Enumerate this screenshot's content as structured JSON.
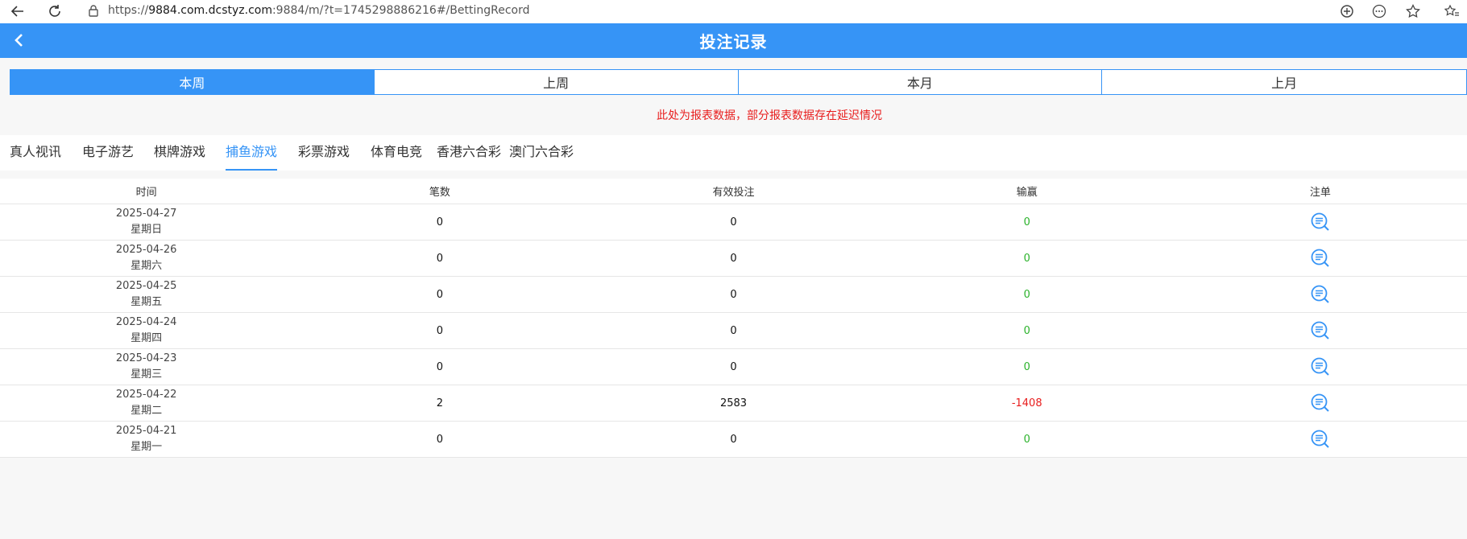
{
  "browser": {
    "url_prefix": "https://",
    "url_host": "9884.com.dcstyz.com",
    "url_rest": ":9884/m/?t=1745298886216#/BettingRecord",
    "icons": [
      "back-icon",
      "reload-icon",
      "lock-icon",
      "translate-icon",
      "more-icon",
      "star-icon",
      "favorites-icon"
    ]
  },
  "header": {
    "title": "投注记录"
  },
  "period_tabs": [
    {
      "label": "本周",
      "active": true
    },
    {
      "label": "上周",
      "active": false
    },
    {
      "label": "本月",
      "active": false
    },
    {
      "label": "上月",
      "active": false
    }
  ],
  "notice": "此处为报表数据，部分报表数据存在延迟情况",
  "category_tabs": [
    {
      "label": "真人视讯",
      "active": false
    },
    {
      "label": "电子游艺",
      "active": false
    },
    {
      "label": "棋牌游戏",
      "active": false
    },
    {
      "label": "捕鱼游戏",
      "active": true
    },
    {
      "label": "彩票游戏",
      "active": false
    },
    {
      "label": "体育电竞",
      "active": false
    },
    {
      "label": "香港六合彩",
      "active": false
    },
    {
      "label": "澳门六合彩",
      "active": false
    }
  ],
  "table": {
    "headers": [
      "时间",
      "笔数",
      "有效投注",
      "输赢",
      "注单"
    ],
    "rows": [
      {
        "date": "2025-04-27",
        "weekday": "星期日",
        "count": "0",
        "valid_bet": "0",
        "win_loss": "0"
      },
      {
        "date": "2025-04-26",
        "weekday": "星期六",
        "count": "0",
        "valid_bet": "0",
        "win_loss": "0"
      },
      {
        "date": "2025-04-25",
        "weekday": "星期五",
        "count": "0",
        "valid_bet": "0",
        "win_loss": "0"
      },
      {
        "date": "2025-04-24",
        "weekday": "星期四",
        "count": "0",
        "valid_bet": "0",
        "win_loss": "0"
      },
      {
        "date": "2025-04-23",
        "weekday": "星期三",
        "count": "0",
        "valid_bet": "0",
        "win_loss": "0"
      },
      {
        "date": "2025-04-22",
        "weekday": "星期二",
        "count": "2",
        "valid_bet": "2583",
        "win_loss": "-1408"
      },
      {
        "date": "2025-04-21",
        "weekday": "星期一",
        "count": "0",
        "valid_bet": "0",
        "win_loss": "0"
      }
    ]
  },
  "colors": {
    "accent": "#3694f6",
    "positive": "#2bb22b",
    "negative": "#e81d1d"
  }
}
